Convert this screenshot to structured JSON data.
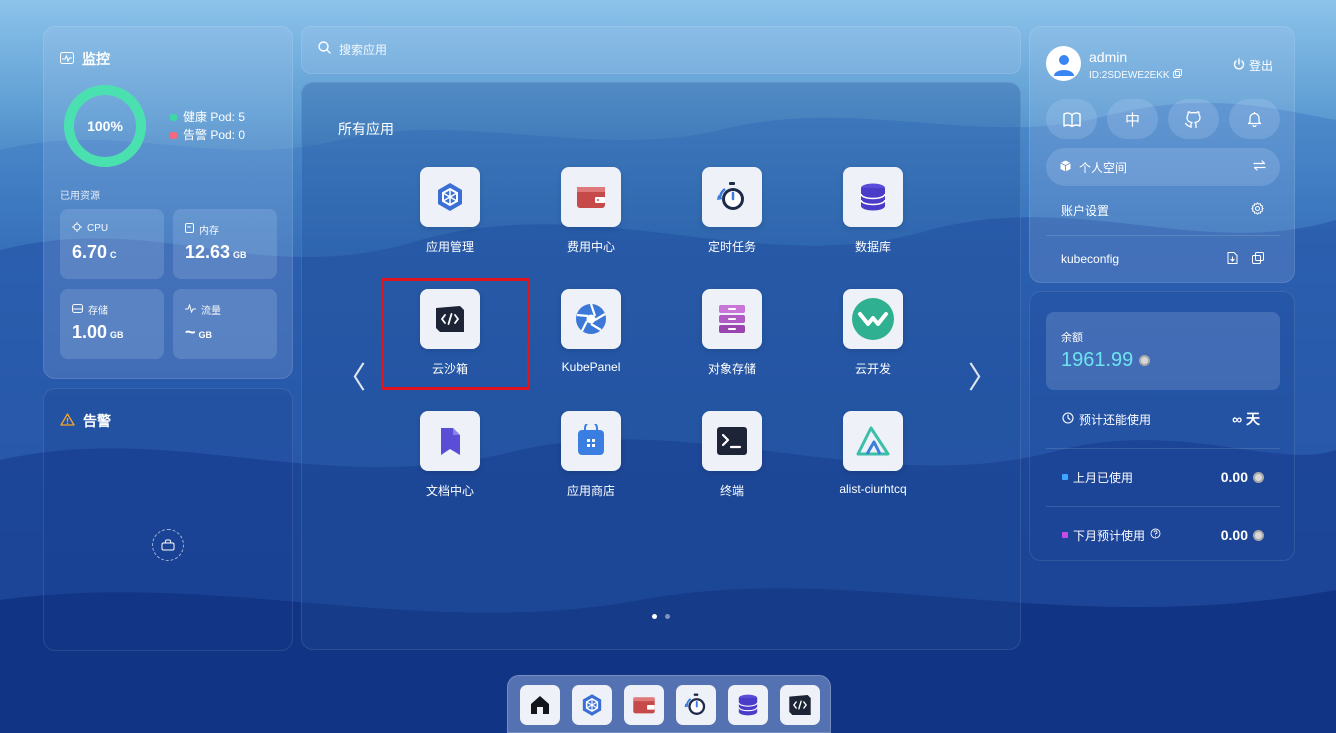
{
  "monitor": {
    "title": "监控",
    "health_percent": "100%",
    "health_fraction": 1.0,
    "healthy_pods": "健康 Pod: 5",
    "alert_pods": "告警 Pod: 0",
    "used_resources_label": "已用资源",
    "stats": [
      {
        "label": "CPU",
        "value": "6.70",
        "unit": "C",
        "icon": "cpu-icon"
      },
      {
        "label": "内存",
        "value": "12.63",
        "unit": "GB",
        "icon": "memory-icon"
      },
      {
        "label": "存储",
        "value": "1.00",
        "unit": "GB",
        "icon": "storage-icon"
      },
      {
        "label": "流量",
        "value": "~",
        "unit": "GB",
        "icon": "traffic-icon"
      }
    ]
  },
  "alert": {
    "title": "告警"
  },
  "search": {
    "placeholder": "搜索应用"
  },
  "apps": {
    "title": "所有应用",
    "items": [
      {
        "name": "应用管理",
        "icon": "app-manage-icon"
      },
      {
        "name": "费用中心",
        "icon": "cost-center-icon"
      },
      {
        "name": "定时任务",
        "icon": "cron-job-icon"
      },
      {
        "name": "数据库",
        "icon": "database-icon"
      },
      {
        "name": "云沙箱",
        "icon": "cloud-sandbox-icon"
      },
      {
        "name": "KubePanel",
        "icon": "kubepanel-icon"
      },
      {
        "name": "对象存储",
        "icon": "object-storage-icon"
      },
      {
        "name": "云开发",
        "icon": "cloud-dev-icon"
      },
      {
        "name": "文档中心",
        "icon": "docs-icon"
      },
      {
        "name": "应用商店",
        "icon": "app-store-icon"
      },
      {
        "name": "终端",
        "icon": "terminal-icon"
      },
      {
        "name": "alist-ciurhtcq",
        "icon": "alist-icon"
      }
    ],
    "prev": "〈",
    "next": "〉",
    "page_current": 1,
    "page_total": 2
  },
  "user": {
    "name": "admin",
    "id": "ID:2SDEWE2EKK",
    "logout": "登出",
    "lang": "中",
    "space": "个人空间",
    "account_settings": "账户设置",
    "kubeconfig": "kubeconfig"
  },
  "balance": {
    "label": "余额",
    "value": "1961.99",
    "remaining_label": "预计还能使用",
    "remaining_value": "∞ 天",
    "last_month_label": "上月已使用",
    "last_month_value": "0.00",
    "next_month_label": "下月预计使用",
    "next_month_value": "0.00"
  },
  "colors": {
    "healthy": "#3ed6a6",
    "alert": "#f26a7d",
    "ring": "#4be0b0",
    "balance": "#6ee3f0",
    "last_month": "#3ea6ff",
    "next_month": "#c84be8",
    "highlight": "#e0141c"
  }
}
